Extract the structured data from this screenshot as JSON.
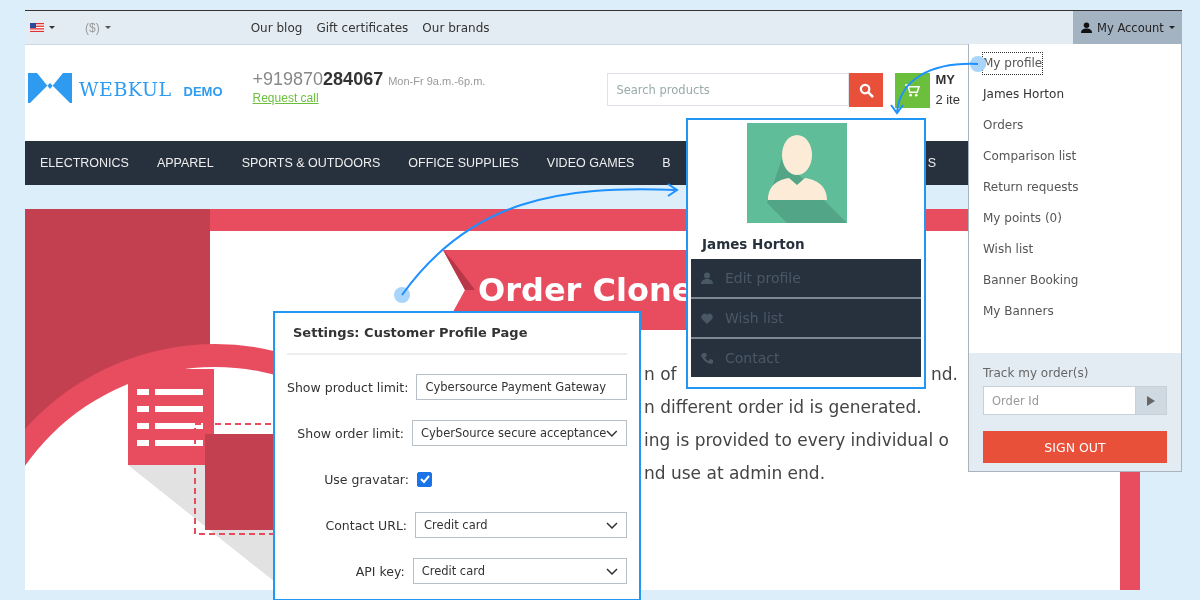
{
  "top_bar": {
    "currency": "($)",
    "links": [
      "Our blog",
      "Gift certificates",
      "Our brands"
    ],
    "account_button": "My Account"
  },
  "header": {
    "logo": {
      "name": "WEBKUL",
      "tag": "DEMO"
    },
    "phone": {
      "prefix": "+919870",
      "number": "284067",
      "hours": "Mon-Fr 9a.m.-6p.m."
    },
    "request_call": "Request call",
    "search": {
      "placeholder": "Search products"
    },
    "cart": {
      "title": "MY",
      "items": "2 ite"
    }
  },
  "nav": [
    "ELECTRONICS",
    "APPAREL",
    "SPORTS & OUTDOORS",
    "OFFICE SUPPLIES",
    "VIDEO GAMES",
    "B",
    "S"
  ],
  "banner": {
    "title": "Order Clone",
    "lines": [
      [
        "n of",
        "nd."
      ],
      [
        "n different order id is generated."
      ],
      [
        "ing is provided to every individual o"
      ],
      [
        "nd use at admin end."
      ]
    ]
  },
  "settings": {
    "title": "Settings: Customer Profile Page",
    "fields": [
      {
        "label": "Show product limit:",
        "kind": "text",
        "value": "Cybersource Payment Gateway"
      },
      {
        "label": "Show order limit:",
        "kind": "select",
        "value": "CyberSource secure acceptance"
      },
      {
        "label": "Use gravatar:",
        "kind": "checkbox",
        "checked": true
      },
      {
        "label": "Contact URL:",
        "kind": "select",
        "value": "Credit card"
      },
      {
        "label": "API key:",
        "kind": "select",
        "value": "Credit card"
      }
    ]
  },
  "profile_card": {
    "name": "James Horton",
    "menu": [
      "Edit profile",
      "Wish list",
      "Contact"
    ]
  },
  "account_menu": {
    "items": [
      {
        "label": "My profile",
        "selected": true
      },
      {
        "label": "James Horton",
        "selected": false
      },
      {
        "label": "Orders",
        "selected": false
      },
      {
        "label": "Comparison list",
        "selected": false
      },
      {
        "label": "Return requests",
        "selected": false
      },
      {
        "label": "My points (0)",
        "selected": false
      },
      {
        "label": "Wish list",
        "selected": false
      },
      {
        "label": "Banner Booking",
        "selected": false
      },
      {
        "label": "My Banners",
        "selected": false
      }
    ],
    "track_label": "Track my order(s)",
    "order_placeholder": "Order Id",
    "sign_out": "SIGN OUT"
  }
}
